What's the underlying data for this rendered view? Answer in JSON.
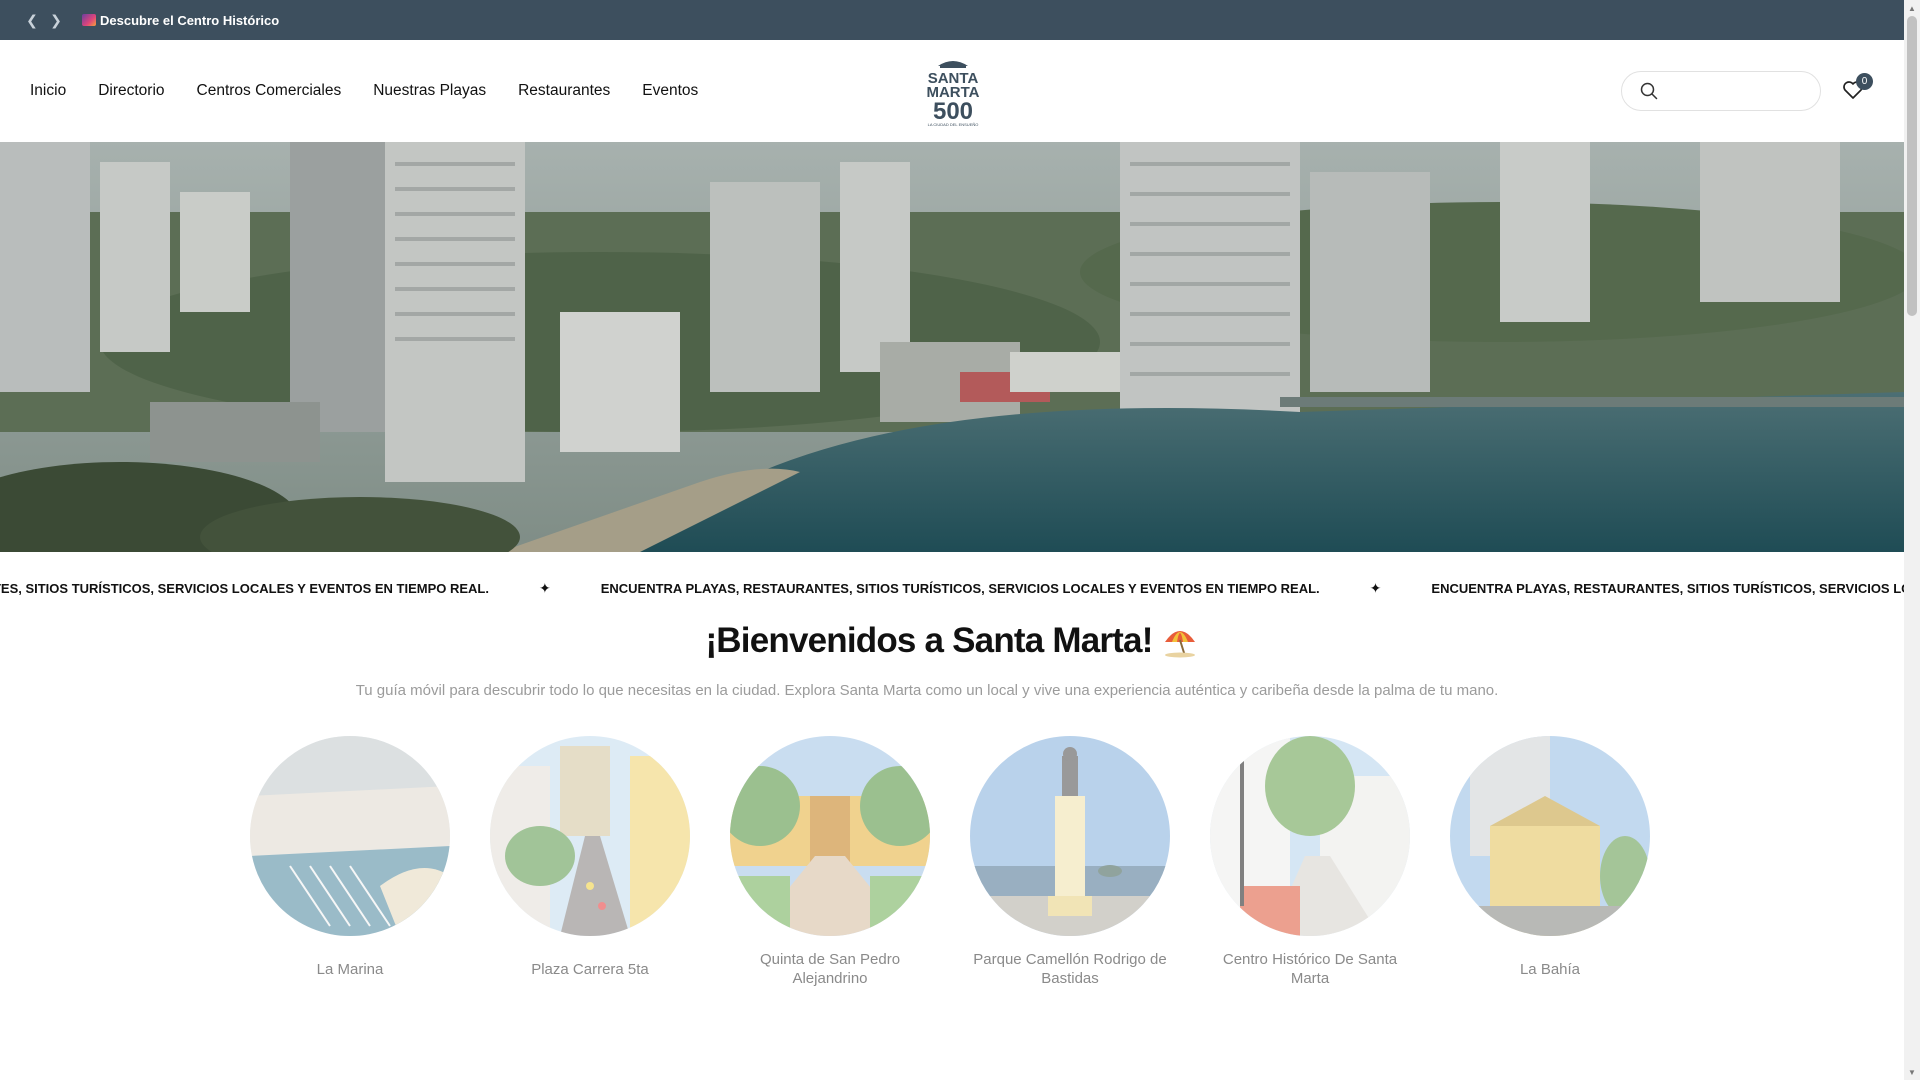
{
  "announcement": {
    "prev_icon": "chevron-left-icon",
    "next_icon": "chevron-right-icon",
    "message": "Descubre el Centro Histórico"
  },
  "nav": {
    "items": [
      "Inicio",
      "Directorio",
      "Centros Comerciales",
      "Nuestras Playas",
      "Restaurantes",
      "Eventos"
    ]
  },
  "logo": {
    "line1": "SANTA",
    "line2": "MARTA",
    "number": "500",
    "tagline": "LA CIUDAD DEL ENSUEÑO"
  },
  "search": {
    "placeholder": "",
    "icon": "search-icon"
  },
  "wishlist": {
    "icon": "heart-icon",
    "count": "0"
  },
  "marquee": {
    "text": "ENCUENTRA PLAYAS, RESTAURANTES, SITIOS TURÍSTICOS, SERVICIOS LOCALES Y EVENTOS EN TIEMPO REAL.",
    "separator": "✦"
  },
  "welcome": {
    "title": "¡Bienvenidos a Santa Marta!",
    "subtitle": "Tu guía móvil para descubrir todo lo que necesitas en la ciudad. Explora Santa Marta como un local y vive una experiencia auténtica y caribeña desde la palma de tu mano."
  },
  "places": [
    {
      "name": "La Marina"
    },
    {
      "name": "Plaza Carrera 5ta"
    },
    {
      "name": "Quinta de San Pedro Alejandrino"
    },
    {
      "name": "Parque Camellón Rodrigo de Bastidas"
    },
    {
      "name": "Centro Histórico De Santa Marta"
    },
    {
      "name": "La Bahía"
    }
  ],
  "colors": {
    "announcement_bg": "#3d4f5e",
    "badge_bg": "#3d4f5e",
    "muted_text": "#9b9b9b"
  }
}
